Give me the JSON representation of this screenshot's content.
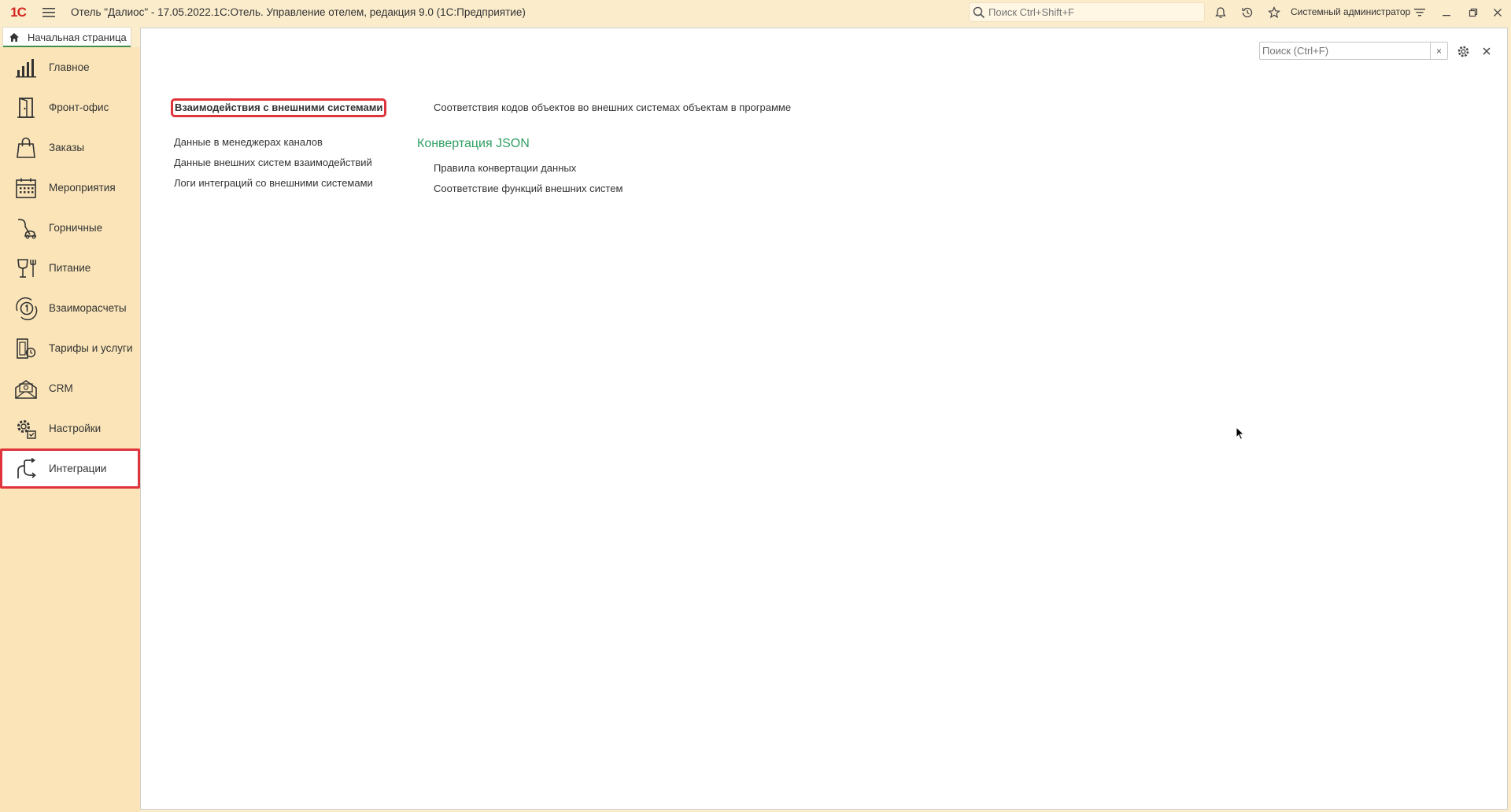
{
  "titlebar": {
    "logo_text": "1С",
    "title": "Отель \"Далиос\" - 17.05.2022.1С:Отель. Управление отелем, редакция 9.0  (1С:Предприятие)",
    "search_placeholder": "Поиск Ctrl+Shift+F",
    "user": "Системный администратор"
  },
  "tabs": {
    "home_label": "Начальная страница"
  },
  "sidebar": {
    "items": [
      {
        "label": "Главное",
        "icon": "bar-chart-icon"
      },
      {
        "label": "Фронт-офис",
        "icon": "door-icon"
      },
      {
        "label": "Заказы",
        "icon": "shopping-bag-icon"
      },
      {
        "label": "Мероприятия",
        "icon": "calendar-icon"
      },
      {
        "label": "Горничные",
        "icon": "vacuum-icon"
      },
      {
        "label": "Питание",
        "icon": "cup-fork-icon"
      },
      {
        "label": "Взаиморасчеты",
        "icon": "coin-cycle-icon"
      },
      {
        "label": "Тарифы и услуги",
        "icon": "tariff-icon"
      },
      {
        "label": "CRM",
        "icon": "crm-mail-icon"
      },
      {
        "label": "Настройки",
        "icon": "gears-icon"
      },
      {
        "label": "Интеграции",
        "icon": "integration-arrows-icon"
      }
    ],
    "active_index": 10
  },
  "main": {
    "search_placeholder": "Поиск (Ctrl+F)",
    "clear_label": "×",
    "col1": {
      "header_link": "Взаимодействия с внешними системами",
      "links": [
        "Данные в менеджерах каналов",
        "Данные внешних систем взаимодействий",
        "Логи интеграций со внешними системами"
      ]
    },
    "col2": {
      "top_link": "Соответствия кодов объектов во внешних системах объектам в программе",
      "group_title": "Конвертация JSON",
      "group_links": [
        "Правила конвертации данных",
        "Соответствие функций внешних систем"
      ]
    }
  },
  "colors": {
    "accent_green": "#2f9e62",
    "highlight_red": "#e0343c",
    "sidebar_bg": "#fbe5b8",
    "titlebar_bg": "#fbeccc"
  }
}
